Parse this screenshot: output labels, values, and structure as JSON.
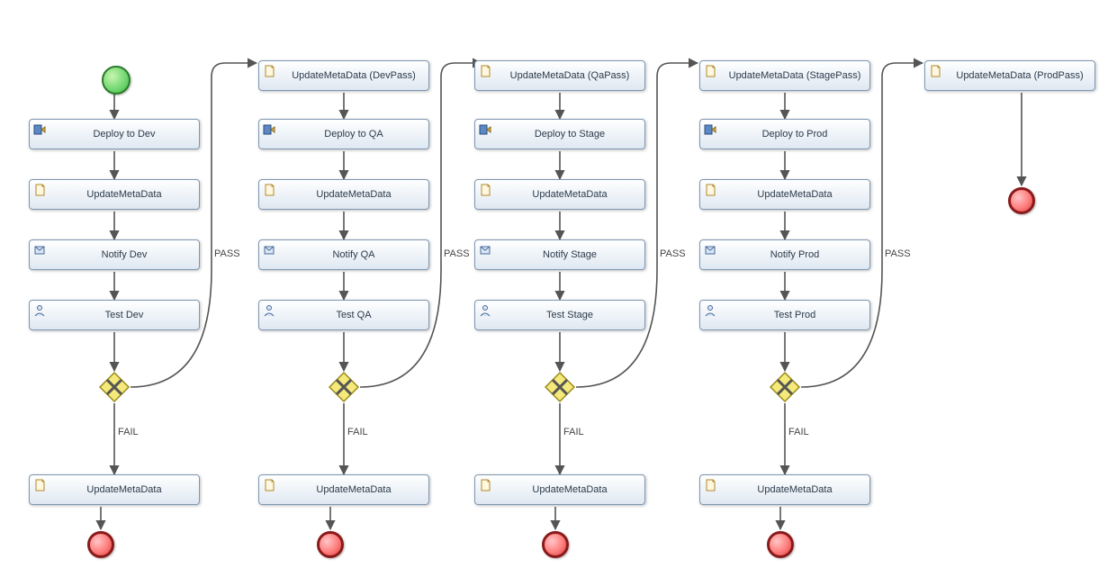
{
  "labels": {
    "pass": "PASS",
    "fail": "FAIL"
  },
  "columns": [
    {
      "top_task": null,
      "tasks": [
        {
          "label": "Deploy to Dev",
          "icon": "deploy"
        },
        {
          "label": "UpdateMetaData",
          "icon": "script"
        },
        {
          "label": "Notify Dev",
          "icon": "notify"
        },
        {
          "label": "Test Dev",
          "icon": "user"
        }
      ],
      "fail_task": {
        "label": "UpdateMetaData",
        "icon": "script"
      }
    },
    {
      "top_task": {
        "label": "UpdateMetaData (DevPass)",
        "icon": "script"
      },
      "tasks": [
        {
          "label": "Deploy to QA",
          "icon": "deploy"
        },
        {
          "label": "UpdateMetaData",
          "icon": "script"
        },
        {
          "label": "Notify QA",
          "icon": "notify"
        },
        {
          "label": "Test QA",
          "icon": "user"
        }
      ],
      "fail_task": {
        "label": "UpdateMetaData",
        "icon": "script"
      }
    },
    {
      "top_task": {
        "label": "UpdateMetaData (QaPass)",
        "icon": "script"
      },
      "tasks": [
        {
          "label": "Deploy to Stage",
          "icon": "deploy"
        },
        {
          "label": "UpdateMetaData",
          "icon": "script"
        },
        {
          "label": "Notify Stage",
          "icon": "notify"
        },
        {
          "label": "Test Stage",
          "icon": "user"
        }
      ],
      "fail_task": {
        "label": "UpdateMetaData",
        "icon": "script"
      }
    },
    {
      "top_task": {
        "label": "UpdateMetaData (StagePass)",
        "icon": "script"
      },
      "tasks": [
        {
          "label": "Deploy to Prod",
          "icon": "deploy"
        },
        {
          "label": "UpdateMetaData",
          "icon": "script"
        },
        {
          "label": "Notify Prod",
          "icon": "notify"
        },
        {
          "label": "Test Prod",
          "icon": "user"
        }
      ],
      "fail_task": {
        "label": "UpdateMetaData",
        "icon": "script"
      }
    },
    {
      "top_task": {
        "label": "UpdateMetaData (ProdPass)",
        "icon": "script"
      },
      "tasks": null,
      "fail_task": null
    }
  ]
}
